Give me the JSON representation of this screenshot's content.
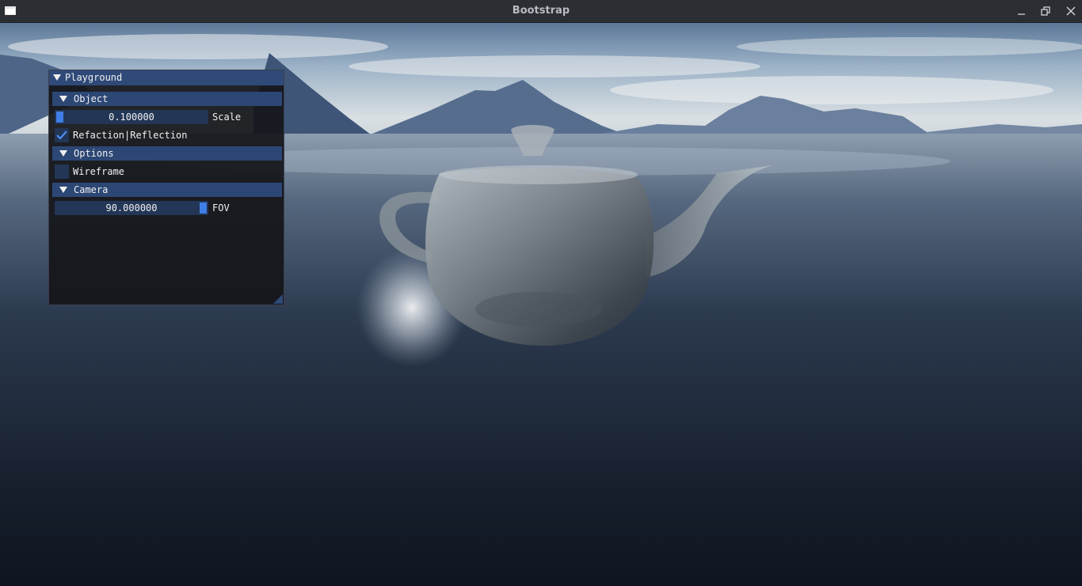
{
  "window": {
    "title": "Bootstrap"
  },
  "panel": {
    "title": "Playground",
    "sections": {
      "object": {
        "header": "Object",
        "scale": {
          "value": "0.100000",
          "label": "Scale",
          "level": 0.0
        },
        "refraction_toggle": {
          "label": "Refaction|Reflection",
          "checked": true
        }
      },
      "options": {
        "header": "Options",
        "wireframe_toggle": {
          "label": "Wireframe",
          "checked": false
        }
      },
      "camera": {
        "header": "Camera",
        "fov": {
          "value": "90.000000",
          "label": "FOV",
          "level": 1.0
        }
      }
    }
  },
  "colors": {
    "accent": "#3f7ee6",
    "header_bg": "#2d4775",
    "frame_bg": "#233656"
  },
  "icons": {
    "minimize": "minimize-icon",
    "restore": "restore-icon",
    "close": "close-icon",
    "collapse": "collapse-arrow-icon",
    "check": "checkmark-icon"
  }
}
